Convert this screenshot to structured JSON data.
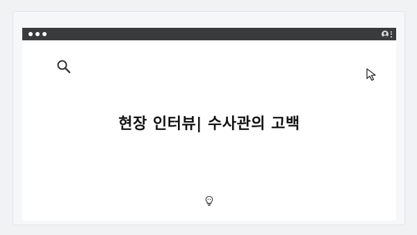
{
  "page": {
    "headline": "현장 인터뷰| 수사관의 고백"
  },
  "window": {
    "traffic_lights": [
      "window-dot",
      "window-dot",
      "window-dot"
    ],
    "titlebar_icons": [
      "profile-icon",
      "kebab-menu-icon"
    ]
  },
  "icons": {
    "search": "search-icon",
    "cursor": "cursor-icon",
    "assistant": "lightbulb-icon"
  },
  "colors": {
    "page_background": "#f1f2f4",
    "titlebar": "#3a3b3d",
    "window_background": "#ffffff",
    "headline_text": "#111111"
  }
}
